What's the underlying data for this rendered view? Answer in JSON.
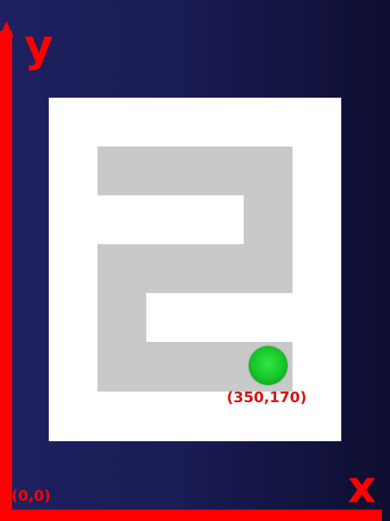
{
  "axes": {
    "y_label": "y",
    "x_label": "x",
    "origin_label": "(0,0)",
    "color": "#ff0000"
  },
  "maze": {
    "board_color": "#ffffff",
    "path_color": "#c9c9c9"
  },
  "ball": {
    "coordinate_label": "(350,170)",
    "color": "#1fd432",
    "icon": "green-ball-icon"
  },
  "background": {
    "gradient_start": "#1e2060",
    "gradient_end": "#0e0e30"
  }
}
